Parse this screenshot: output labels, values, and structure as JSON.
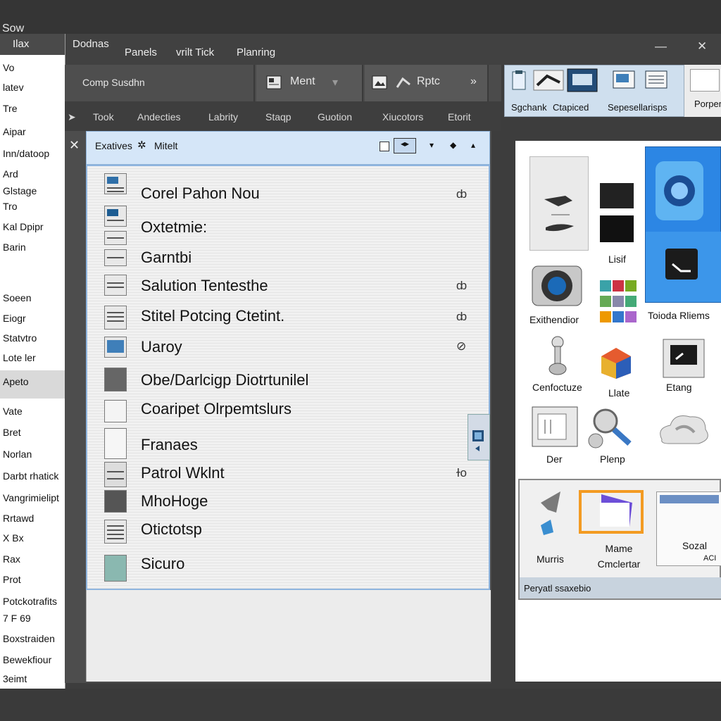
{
  "app": {
    "title": "Sow"
  },
  "menu": {
    "items": [
      "Dodnas",
      "Panels",
      "vrilt Tick",
      "Planring"
    ],
    "window_controls": [
      "—",
      "✕"
    ]
  },
  "left_panel": {
    "header": "Ilax",
    "items": [
      "Vo",
      "latev",
      "Tre",
      "Aipar",
      "Inn/datoop",
      "Ard",
      "Glstage",
      "Tro",
      "Kal Dpipr",
      "Barin",
      "Soeen",
      "Eiogr",
      "Statvtro",
      "Lote ler",
      "Apeto",
      "Vate",
      "Bret",
      "Norlan",
      "Darbt rhatick",
      "Vangrimielipt",
      "Rrtawd",
      "X Bx",
      "Rax",
      "Prot",
      "Potckotrafits",
      "7 F 69",
      "Boxstraiden",
      "Bewekfiour",
      "3eimt"
    ],
    "selected_index": 14
  },
  "toolbar": {
    "combo_label": "Comp Susdhn",
    "menu_label": "Ment",
    "menu_dropdown": "▾",
    "rptc_label": "Rptc",
    "more": "»"
  },
  "tabs": [
    "Took",
    "Andecties",
    "Labrity",
    "Staqp",
    "Guotion",
    "Xiucotors",
    "Etorit"
  ],
  "list": {
    "header_label": "Exatives",
    "header_sub": "Mitelt",
    "rows": [
      {
        "label": "Corel Pahon Nou",
        "meta": "ȸ"
      },
      {
        "label": "Oxtetmie:",
        "meta": ""
      },
      {
        "label": "Garntbi",
        "meta": ""
      },
      {
        "label": "Salution Tentesthe",
        "meta": "ȸ"
      },
      {
        "label": "Stitel Potcing Ctetint.",
        "meta": "ȸ"
      },
      {
        "label": "Uaroy",
        "meta": "⊘"
      },
      {
        "label": "Obe/Darlcigp Diotrtunilel",
        "meta": ""
      },
      {
        "label": "Coaripet Olrpemtslurs",
        "meta": ""
      },
      {
        "label": "Franaes",
        "meta": ""
      },
      {
        "label": "Patrol Wklnt",
        "meta": "ɫo"
      },
      {
        "label": "MhoHoge",
        "meta": ""
      },
      {
        "label": "Otictotsp",
        "meta": ""
      },
      {
        "label": "Sicuro",
        "meta": ""
      }
    ]
  },
  "right_panel": {
    "tabs": [
      "Sgchank",
      "Ctapiced",
      "Sepesellarisps",
      "Porper"
    ],
    "tiles": [
      {
        "label": "Lisif",
        "icon": "dark-swatch-icon"
      },
      {
        "label": "Exithendior",
        "icon": "camera-icon"
      },
      {
        "label": "Toioda Rliems",
        "icon": "webcam-icon"
      },
      {
        "label": "Cenfoctuze",
        "icon": "joystick-icon"
      },
      {
        "label": "Llate",
        "icon": "color-cube-icon"
      },
      {
        "label": "Etang",
        "icon": "monitor-icon"
      },
      {
        "label": "Der",
        "icon": "window-icon"
      },
      {
        "label": "Plenp",
        "icon": "magnifier-icon"
      },
      {
        "label": "",
        "icon": "cloud-icon"
      }
    ],
    "bottom": {
      "items": [
        "Murris",
        "Mame Cmclertar",
        "Sozal"
      ],
      "corner_label": "ACI",
      "status": "Peryatl ssaxebio"
    }
  },
  "colors": {
    "accent": "#8fb5df",
    "header_blue": "#d5e6f8",
    "dark_bg": "#3d3d3d"
  }
}
